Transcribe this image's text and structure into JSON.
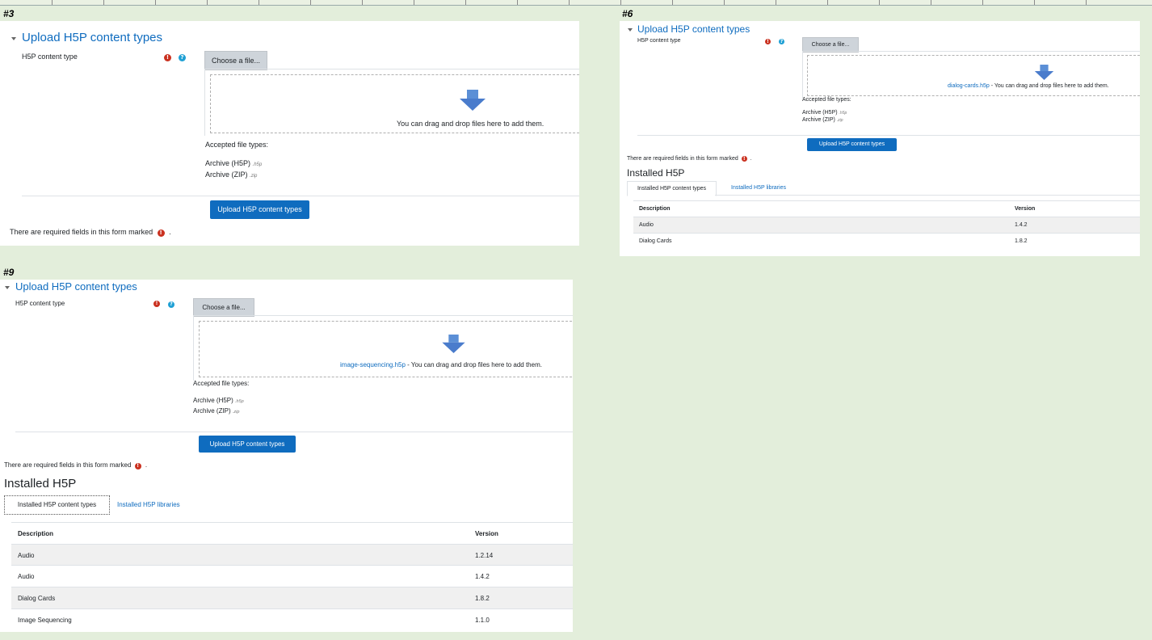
{
  "labels": {
    "s3": "#3",
    "s6": "#6",
    "s9": "#9"
  },
  "form": {
    "heading": "Upload H5P content types",
    "field_label": "H5P content type",
    "choose_label": "Choose a file...",
    "drop_text": "You can drag and drop files here to add them.",
    "drop_suffix": " - You can drag and drop files here to add them.",
    "accepted_label": "Accepted file types:",
    "types": [
      {
        "name": "Archive (H5P)",
        "ext": ".h5p"
      },
      {
        "name": "Archive (ZIP)",
        "ext": ".zip"
      }
    ],
    "upload_label": "Upload H5P content types",
    "required_note": "There are required fields in this form marked",
    "required_glyph": "!",
    "help_glyph": "?",
    "period": "."
  },
  "s6": {
    "file": "dialog-cards.h5p",
    "installed_title": "Installed H5P",
    "tabs": [
      "Installed H5P content types",
      "Installed H5P libraries"
    ],
    "columns": [
      "Description",
      "Version"
    ],
    "rows": [
      {
        "description": "Audio",
        "version": "1.4.2"
      },
      {
        "description": "Dialog Cards",
        "version": "1.8.2"
      }
    ]
  },
  "s9": {
    "file": "image-sequencing.h5p",
    "installed_title": "Installed H5P",
    "tabs": [
      "Installed H5P content types",
      "Installed H5P libraries"
    ],
    "columns": [
      "Description",
      "Version"
    ],
    "rows": [
      {
        "description": "Audio",
        "version": "1.2.14"
      },
      {
        "description": "Audio",
        "version": "1.4.2"
      },
      {
        "description": "Dialog Cards",
        "version": "1.8.2"
      },
      {
        "description": "Image Sequencing",
        "version": "1.1.0"
      }
    ]
  },
  "colors": {
    "background": "#e3eedb",
    "brand": "#0f6cbf",
    "required": "#ca3120",
    "help": "#1fa0d4"
  }
}
